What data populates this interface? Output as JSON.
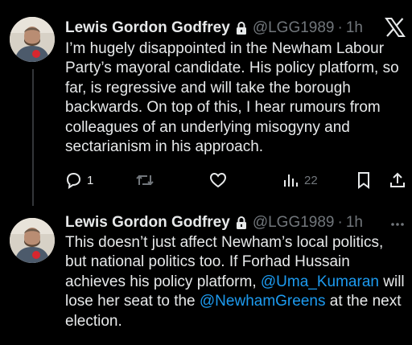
{
  "tweets": [
    {
      "author_name": "Lewis Gordon Godfrey",
      "handle": "@LGG1989",
      "separator": "·",
      "time": "1h",
      "text": "I’m hugely disappointed in the Newham Labour Party’s mayoral candidate. His policy platform, so far, is regressive and will take the borough backwards. On top of this, I hear rumours from colleagues of an underlying misogyny and sectarianism in his approach.",
      "actions": {
        "reply_count": "1",
        "repost_count": "",
        "like_count": "",
        "views_count": "22"
      },
      "icons": [
        "lock-icon",
        "x-logo-icon",
        "reply-icon",
        "repost-icon",
        "like-icon",
        "views-icon",
        "bookmark-icon",
        "share-icon"
      ]
    },
    {
      "author_name": "Lewis Gordon Godfrey",
      "handle": "@LGG1989",
      "separator": "·",
      "time": "1h",
      "text_part1": "This doesn’t just affect Newham’s local politics, but national politics too. If Forhad Hussain achieves his policy platform, ",
      "mention1": "@Uma_Kumaran",
      "text_part2": " will lose her seat to the ",
      "mention2": "@NewhamGreens",
      "text_part3": " at the next election.",
      "icons": [
        "lock-icon",
        "more-icon"
      ]
    }
  ],
  "colors": {
    "background": "#000000",
    "text": "#e7e9ea",
    "secondary": "#71767b",
    "link": "#1d9bf0",
    "thread_line": "#333639"
  }
}
